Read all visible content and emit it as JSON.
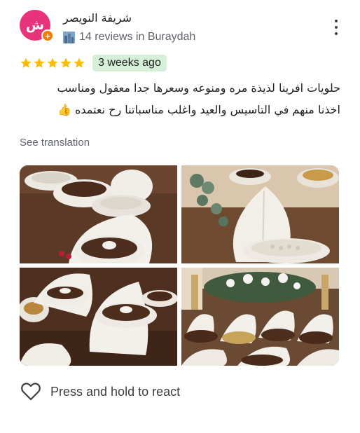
{
  "reviewer": {
    "name": "شريفة النويصر",
    "avatar_text": "ش",
    "badge_text": "+",
    "meta": "14 reviews in Buraydah",
    "avatar_color": "#e8327c",
    "badge_color": "#f57c00"
  },
  "review": {
    "rating": 5,
    "time": "3 weeks ago",
    "lines": [
      "حلويات افرينا لذيذة مره ومنوعه وسعرها جدا معقول ومناسب",
      "اخذنا منهم في التاسيس والعيد واغلب مناسباتنا رح نعتمده 👍"
    ],
    "see_translation": "See translation"
  },
  "photos": [
    {
      "icon": "dessert-platters-photo"
    },
    {
      "icon": "leaf-bowl-sweets-photo"
    },
    {
      "icon": "chocolate-bowls-photo"
    },
    {
      "icon": "dessert-table-flowers-photo"
    }
  ],
  "actions": {
    "react_label": "Press and hold to react"
  },
  "colors": {
    "star": "#fbbc04",
    "chip_bg": "#d6efd8"
  }
}
